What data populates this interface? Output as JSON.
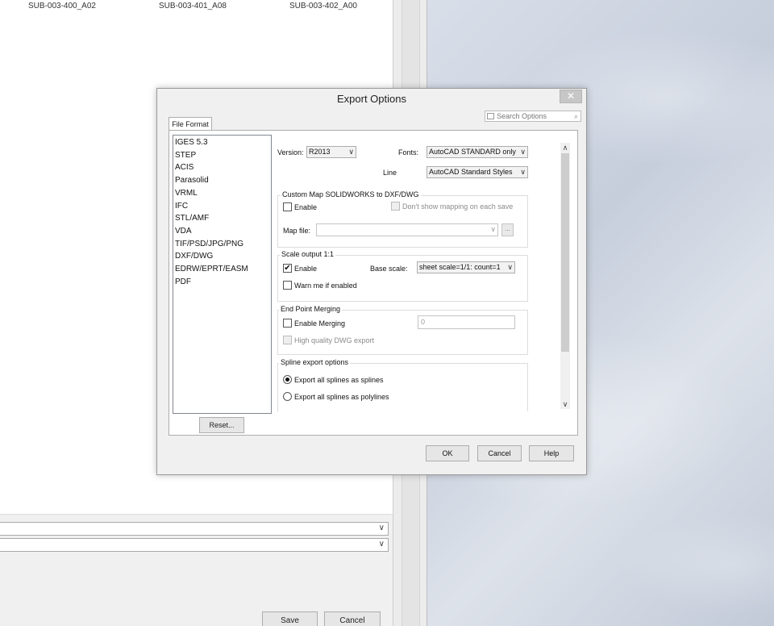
{
  "background_window": {
    "files": [
      "SUB-003-400_A02",
      "SUB-003-401_A08",
      "SUB-003-402_A00"
    ],
    "save_label": "Save",
    "cancel_label": "Cancel"
  },
  "dialog": {
    "title": "Export Options",
    "close_glyph": "✕",
    "search_placeholder": "Search Options",
    "tab_label": "File Format",
    "formats": [
      "IGES 5.3",
      "STEP",
      "ACIS",
      "Parasolid",
      "VRML",
      "IFC",
      "STL/AMF",
      "VDA",
      "TIF/PSD/JPG/PNG",
      "DXF/DWG",
      "EDRW/EPRT/EASM",
      "PDF"
    ],
    "reset_label": "Reset...",
    "version_label": "Version:",
    "version_value": "R2013",
    "fonts_label": "Fonts:",
    "fonts_value": "AutoCAD STANDARD only",
    "line_label": "Line",
    "line_value": "AutoCAD Standard Styles",
    "custom_map": {
      "title": "Custom Map SOLIDWORKS to DXF/DWG",
      "enable_label": "Enable",
      "dont_show_label": "Don't show mapping on each save",
      "map_file_label": "Map file:",
      "browse_label": "..."
    },
    "scale_output": {
      "title": "Scale output 1:1",
      "enable_label": "Enable",
      "enable_checked": true,
      "base_scale_label": "Base scale:",
      "base_scale_value": "sheet scale=1/1: count=1",
      "warn_label": "Warn me if enabled"
    },
    "end_point": {
      "title": "End Point Merging",
      "enable_label": "Enable Merging",
      "merge_value": "0",
      "hq_label": "High quality DWG export"
    },
    "spline": {
      "title": "Spline export options",
      "opt1_label": "Export all splines as splines",
      "opt2_label": "Export all splines as polylines",
      "selected": 1
    },
    "ok_label": "OK",
    "cancel_label": "Cancel",
    "help_label": "Help",
    "check_glyph": "✔",
    "dropdown_glyph": "∨",
    "scroll_up_glyph": "∧",
    "scroll_down_glyph": "∨",
    "search_glyph": "⌕"
  }
}
